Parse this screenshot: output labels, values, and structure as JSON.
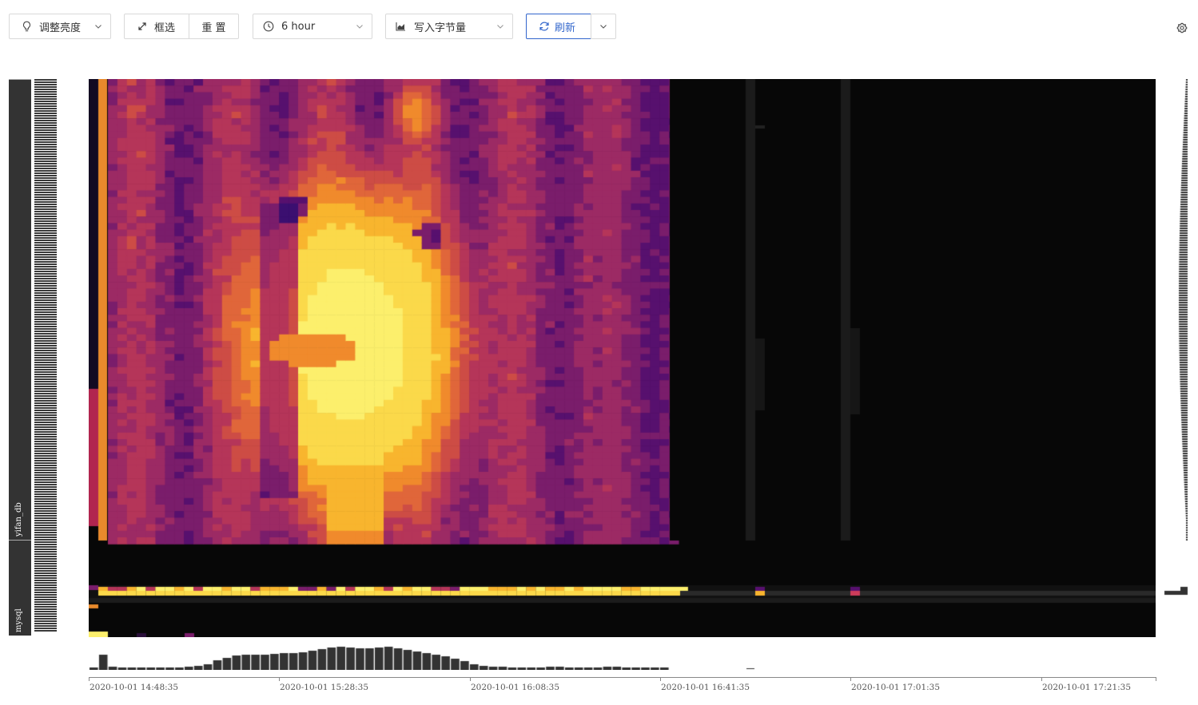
{
  "toolbar": {
    "brightness_label": "调整亮度",
    "select_label": "框选",
    "reset_label": "重 置",
    "time_range": "6 hour",
    "metric": "写入字节量",
    "refresh_label": "刷新"
  },
  "colors": {
    "accent": "#3266cc",
    "heatmap_bg": "#070707",
    "label_bar": "#333333",
    "palette": [
      "#1a0a33",
      "#3b0f70",
      "#57106e",
      "#7a1d6b",
      "#9c2a64",
      "#b53559",
      "#cd4c45",
      "#e0663a",
      "#f08a2c",
      "#f8b52e",
      "#fbd94a",
      "#fcef6c"
    ]
  },
  "icons": {
    "brightness": "lightbulb-icon",
    "select": "resize-arrow-icon",
    "time": "clock-icon",
    "metric": "area-chart-icon",
    "refresh": "refresh-icon",
    "settings": "gear-icon"
  },
  "y_axis": {
    "groups": [
      "yifan_db",
      "mysql"
    ]
  },
  "x_axis": {
    "ticks": [
      "2020-10-01 14:48:35",
      "2020-10-01 15:28:35",
      "2020-10-01 16:08:35",
      "2020-10-01 16:41:35",
      "2020-10-01 17:01:35",
      "2020-10-01 17:21:35"
    ]
  }
}
